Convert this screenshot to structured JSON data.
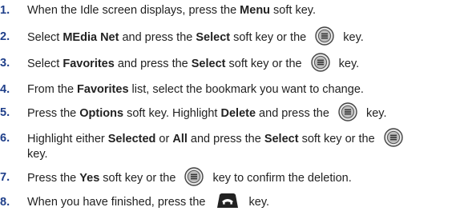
{
  "steps": [
    {
      "num": "1.",
      "a": "When the Idle screen displays, press the ",
      "b": "Menu",
      "c": " soft key."
    },
    {
      "num": "2.",
      "a": "Select ",
      "b": "MEdia Net",
      "c": " and press the ",
      "d": "Select",
      "e": " soft key or the ",
      "f": " key."
    },
    {
      "num": "3.",
      "a": "Select ",
      "b": "Favorites",
      "c": " and press the ",
      "d": "Select",
      "e": " soft key or the ",
      "f": " key."
    },
    {
      "num": "4.",
      "a": "From the ",
      "b": "Favorites",
      "c": " list, select the bookmark you want to change."
    },
    {
      "num": "5.",
      "a": "Press the ",
      "b": "Options",
      "c": " soft key. Highlight ",
      "d": "Delete",
      "e": " and press the ",
      "f": " key."
    },
    {
      "num": "6.",
      "a": "Highlight either ",
      "b": "Selected",
      "c": " or ",
      "d": "All",
      "e": " and press the ",
      "f": "Select",
      "g": " soft key or the ",
      "h": "key."
    },
    {
      "num": "7.",
      "a": "Press the ",
      "b": "Yes",
      "c": " soft key or the ",
      "d": " key to confirm the deletion."
    },
    {
      "num": "8.",
      "a": "When you have finished, press the ",
      "b": " key."
    }
  ],
  "icons": {
    "nav_key": "navigation-key-icon",
    "end_key": "end-key-icon"
  },
  "colors": {
    "step_number": "#1f3f8a",
    "text": "#222222"
  }
}
